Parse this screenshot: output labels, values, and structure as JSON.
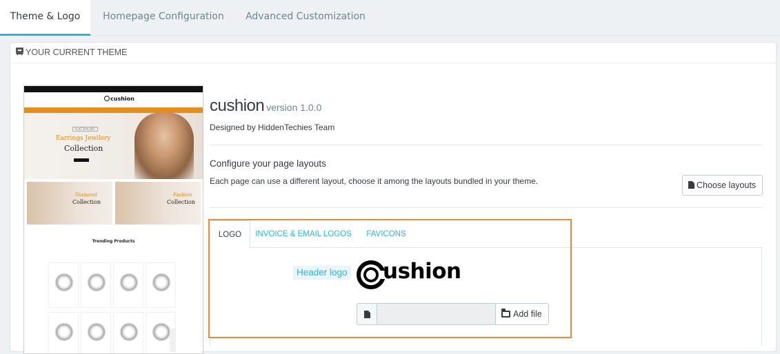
{
  "top_tabs": [
    {
      "label": "Theme & Logo",
      "active": true
    },
    {
      "label": "Homepage Configuration",
      "active": false
    },
    {
      "label": "Advanced Customization",
      "active": false
    }
  ],
  "panel": {
    "heading": "YOUR CURRENT THEME",
    "heading_icon": "html5-icon"
  },
  "preview": {
    "logo_text": "cushion",
    "banner_tag": "FLAT 30% OFF",
    "banner_line1": "Earrings Jewllery",
    "banner_line2": "Collection",
    "promo1_line1": "Diamond",
    "promo1_line2": "Collection",
    "promo2_line1": "Fashion",
    "promo2_line2": "Collection",
    "trending": "Trending Products"
  },
  "theme": {
    "name": "cushion",
    "version": "version 1.0.0",
    "author": "Designed by HiddenTechies Team"
  },
  "layouts": {
    "title": "Configure your page layouts",
    "description": "Each page can use a different layout, choose it among the layouts bundled in your theme.",
    "button_label": "Choose layouts",
    "button_icon": "file-icon"
  },
  "logo_tabs": [
    {
      "label": "LOGO",
      "active": true
    },
    {
      "label": "INVOICE & EMAIL LOGOS",
      "active": false
    },
    {
      "label": "FAVICONS",
      "active": false
    }
  ],
  "header_logo": {
    "label": "Header logo",
    "logo_text": "ushion",
    "add_file_label": "Add file",
    "field_icon": "file-icon",
    "button_icon": "folder-open-icon"
  },
  "colors": {
    "accent": "#25b9d7",
    "highlight": "#ef8a32",
    "brand_orange": "#e58e1a"
  }
}
